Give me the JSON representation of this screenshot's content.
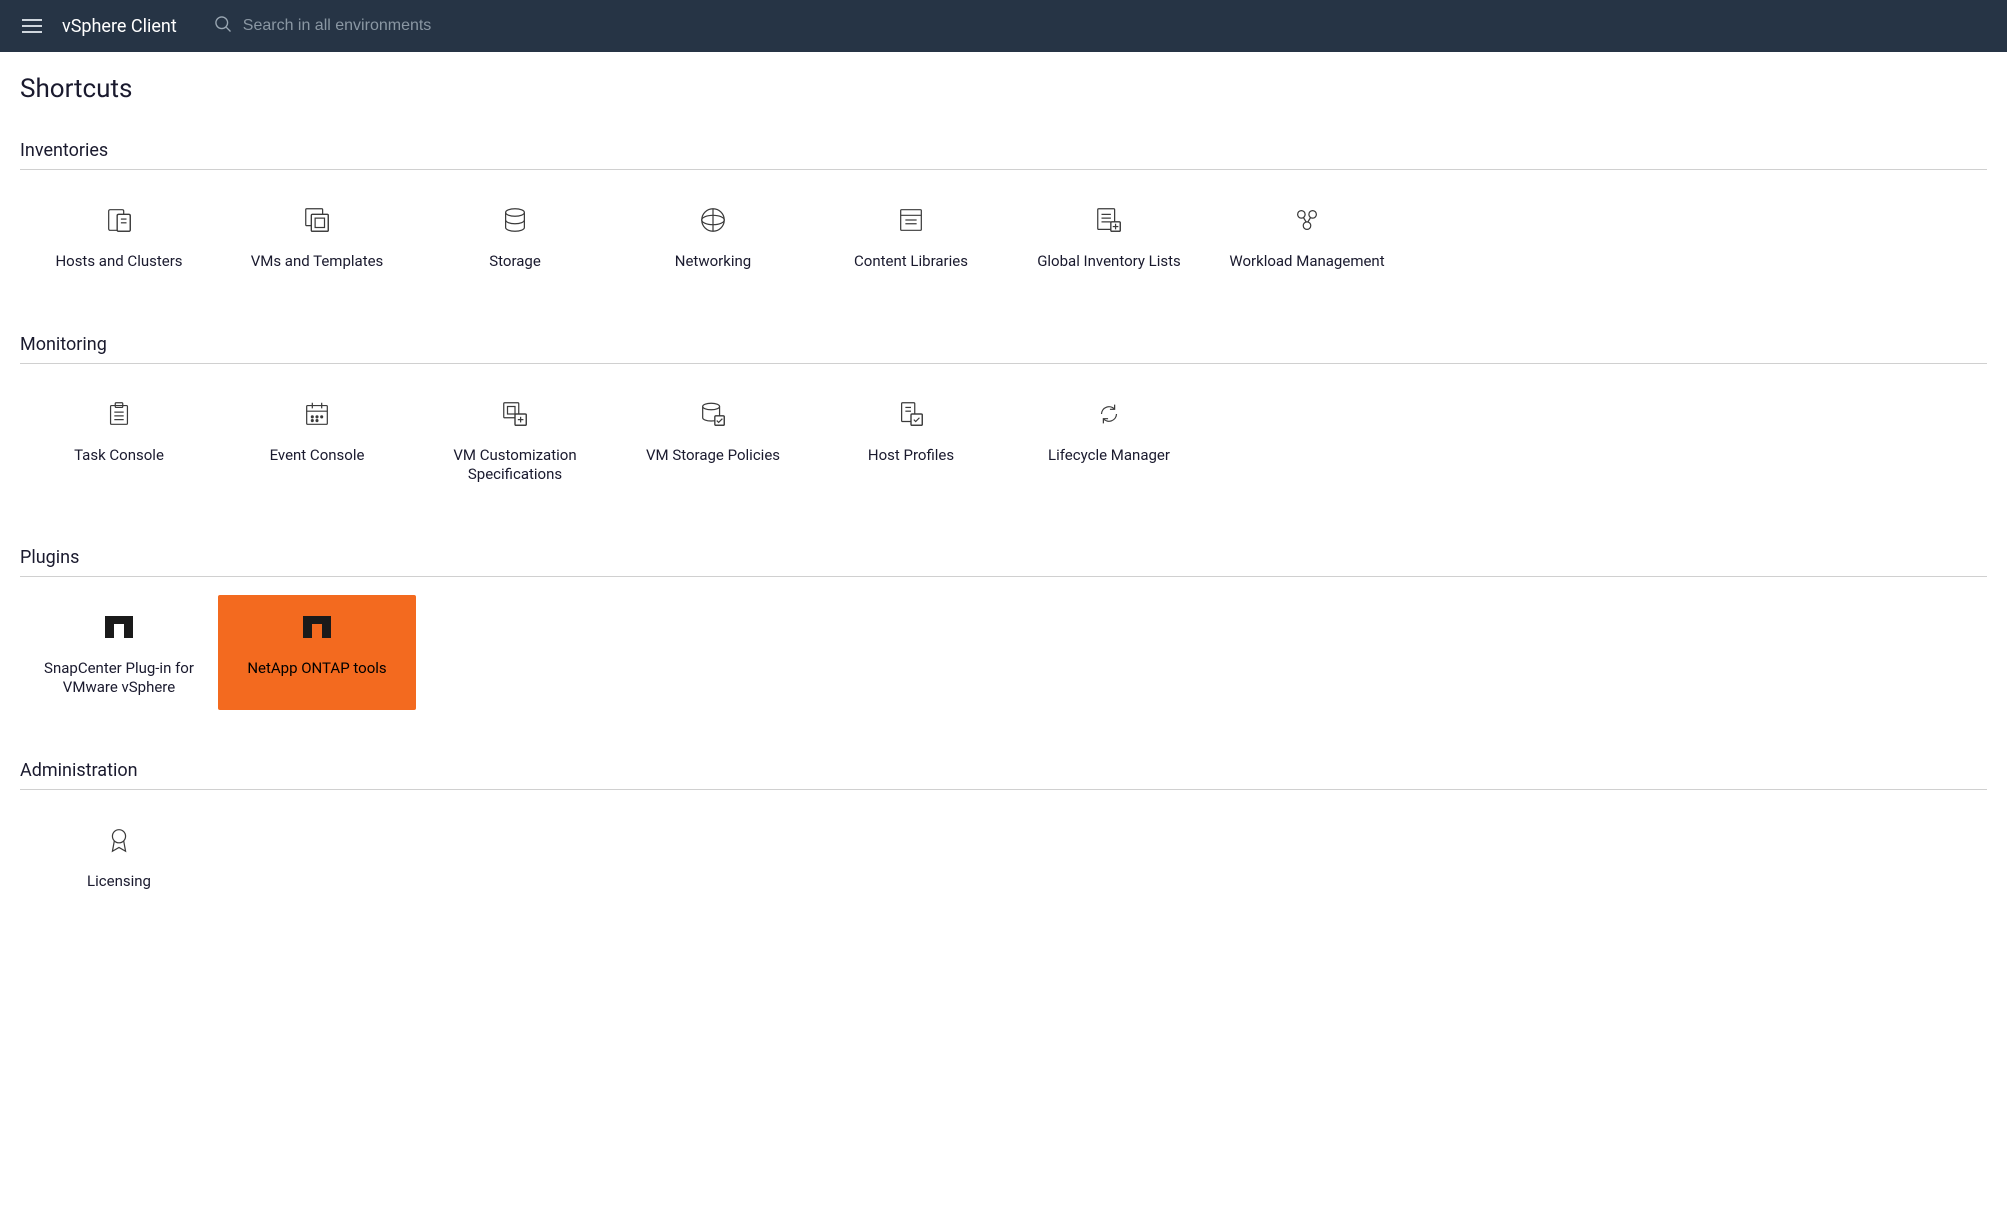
{
  "header": {
    "app_title": "vSphere Client",
    "search_placeholder": "Search in all environments"
  },
  "page": {
    "title": "Shortcuts"
  },
  "sections": {
    "inventories": {
      "title": "Inventories",
      "items": [
        {
          "label": "Hosts and Clusters",
          "icon": "hosts-clusters-icon"
        },
        {
          "label": "VMs and Templates",
          "icon": "vms-templates-icon"
        },
        {
          "label": "Storage",
          "icon": "storage-icon"
        },
        {
          "label": "Networking",
          "icon": "networking-icon"
        },
        {
          "label": "Content Libraries",
          "icon": "content-libraries-icon"
        },
        {
          "label": "Global Inventory Lists",
          "icon": "global-inventory-icon"
        },
        {
          "label": "Workload Management",
          "icon": "workload-management-icon"
        }
      ]
    },
    "monitoring": {
      "title": "Monitoring",
      "items": [
        {
          "label": "Task Console",
          "icon": "task-console-icon"
        },
        {
          "label": "Event Console",
          "icon": "event-console-icon"
        },
        {
          "label": "VM Customization Specifications",
          "icon": "vm-customization-icon"
        },
        {
          "label": "VM Storage Policies",
          "icon": "vm-storage-policies-icon"
        },
        {
          "label": "Host Profiles",
          "icon": "host-profiles-icon"
        },
        {
          "label": "Lifecycle Manager",
          "icon": "lifecycle-manager-icon"
        }
      ]
    },
    "plugins": {
      "title": "Plugins",
      "items": [
        {
          "label": "SnapCenter Plug-in for VMware vSphere",
          "icon": "netapp-icon",
          "highlighted": false
        },
        {
          "label": "NetApp ONTAP tools",
          "icon": "netapp-icon",
          "highlighted": true
        }
      ]
    },
    "administration": {
      "title": "Administration",
      "items": [
        {
          "label": "Licensing",
          "icon": "licensing-icon"
        }
      ]
    }
  }
}
